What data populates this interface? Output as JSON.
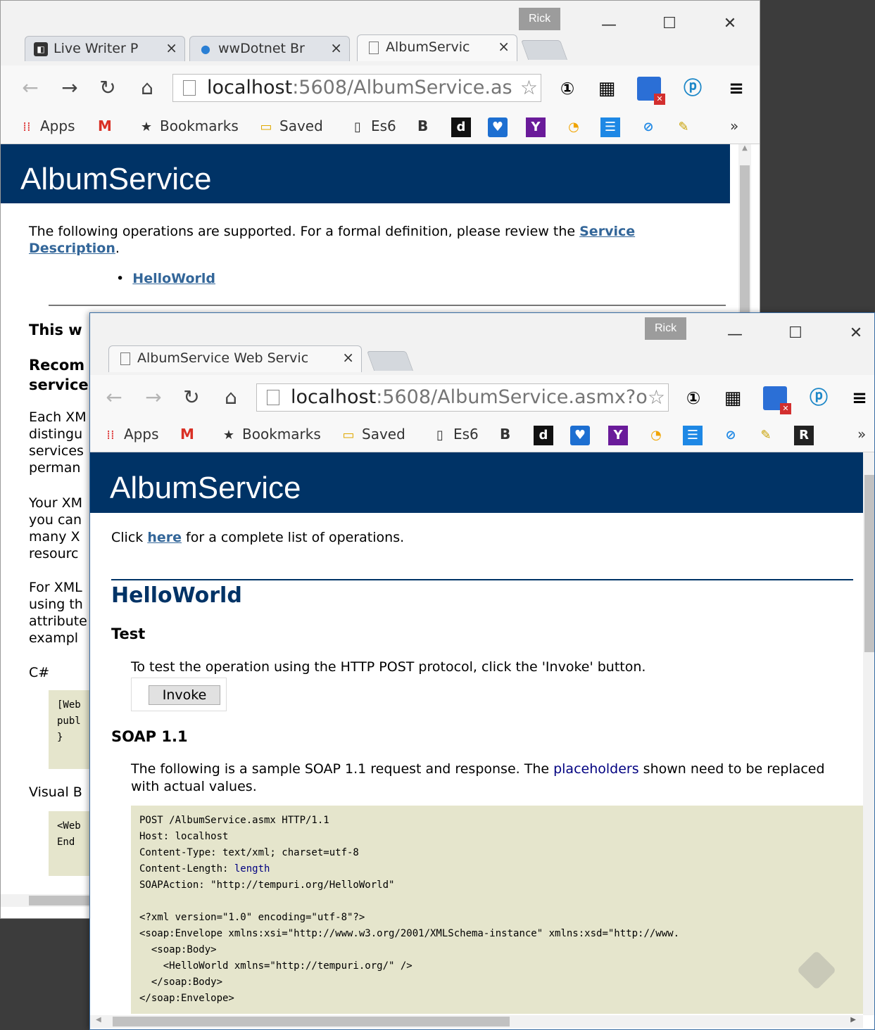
{
  "back_window": {
    "user": "Rick",
    "tabs": [
      {
        "label": "Live Writer P",
        "icon": "live-writer-icon"
      },
      {
        "label": "wwDotnet Br",
        "icon": "wwdotnet-icon"
      },
      {
        "label": "AlbumServic",
        "icon": "page-icon",
        "active": true
      }
    ],
    "url_host": "localhost",
    "url_rest": ":5608/AlbumService.as",
    "bookmarks": {
      "apps": "Apps",
      "bookmarks": "Bookmarks",
      "saved": "Saved",
      "es6": "Es6",
      "b": "B",
      "more": "»"
    },
    "banner_title": "AlbumService",
    "intro_text": "The following operations are supported. For a formal definition, please review the ",
    "service_link_1": "Service",
    "service_link_2": "Description",
    "period": ".",
    "operation": "HelloWorld",
    "visible_fragments": {
      "this_w": "This w",
      "recom": "Recom",
      "service": "service",
      "p1": [
        "Each XM",
        "distingu",
        "services",
        "perman"
      ],
      "p2": [
        "Your XM",
        "you can",
        "many X",
        "resourc"
      ],
      "p3": [
        "For XML",
        "using th",
        "attribute",
        "exampl"
      ],
      "csharp": "C#",
      "code1": [
        "[Web",
        "publ",
        "",
        "}"
      ],
      "visual_b": "Visual B",
      "code2": [
        "<Web",
        "",
        "End"
      ]
    }
  },
  "front_window": {
    "user": "Rick",
    "tab_label": "AlbumService Web Servic",
    "url_host": "localhost",
    "url_rest": ":5608/AlbumService.asmx?o",
    "bookmarks": {
      "apps": "Apps",
      "bookmarks": "Bookmarks",
      "saved": "Saved",
      "es6": "Es6",
      "b": "B",
      "more": "»"
    },
    "banner_title": "AlbumService",
    "click_prefix": "Click ",
    "here_link": "here",
    "click_suffix": " for a complete list of operations.",
    "op_heading": "HelloWorld",
    "test_heading": "Test",
    "test_text": "To test the operation using the HTTP POST protocol, click the 'Invoke' button.",
    "invoke_label": "Invoke",
    "soap_heading": "SOAP 1.1",
    "soap_text_1": "The following is a sample SOAP 1.1 request and response. The ",
    "placeholders_link": "placeholders",
    "soap_text_2": " shown need to be replaced with actual values.",
    "code_lines": [
      "POST /AlbumService.asmx HTTP/1.1",
      "Host: localhost",
      "Content-Type: text/xml; charset=utf-8",
      "Content-Length: ",
      "SOAPAction: \"http://tempuri.org/HelloWorld\"",
      "",
      "<?xml version=\"1.0\" encoding=\"utf-8\"?>",
      "<soap:Envelope xmlns:xsi=\"http://www.w3.org/2001/XMLSchema-instance\" xmlns:xsd=\"http://www.",
      "  <soap:Body>",
      "    <HelloWorld xmlns=\"http://tempuri.org/\" />",
      "  </soap:Body>",
      "</soap:Envelope>"
    ],
    "length_placeholder": "length"
  },
  "colors": {
    "banner": "#003366",
    "link": "#336699",
    "code_bg": "#e5e5cc"
  }
}
